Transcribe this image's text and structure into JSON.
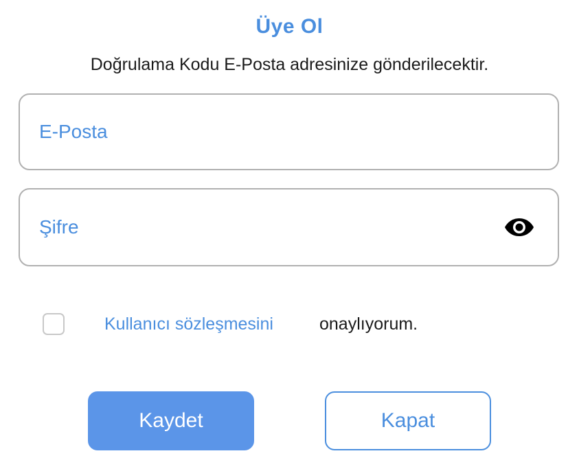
{
  "form": {
    "title": "Üye Ol",
    "subtitle": "Doğrulama Kodu E-Posta adresinize gönderilecektir.",
    "email": {
      "placeholder": "E-Posta",
      "value": ""
    },
    "password": {
      "placeholder": "Şifre",
      "value": "",
      "toggle_icon": "eye-icon"
    },
    "terms": {
      "checked": false,
      "link_label": "Kullanıcı sözleşmesini",
      "suffix": "onaylıyorum."
    },
    "buttons": {
      "save_label": "Kaydet",
      "close_label": "Kapat"
    }
  },
  "colors": {
    "accent": "#4a8ede",
    "primary_button": "#5b95e8",
    "border": "#b0b0b0",
    "text": "#1a1a1a"
  }
}
